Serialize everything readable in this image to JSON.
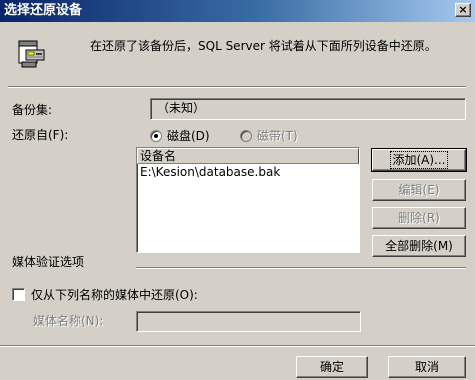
{
  "window": {
    "title": "选择还原设备",
    "close_glyph": "×"
  },
  "header": {
    "icon": "database-device-icon",
    "message": "在还原了该备份后，SQL Server 将试着从下面所列设备中还原。"
  },
  "backup_set": {
    "label": "备份集:",
    "value": "（未知）"
  },
  "restore_from": {
    "label": "还原自(F):",
    "disk_label": "磁盘(D)",
    "tape_label": "磁带(T)",
    "selected": "disk"
  },
  "devices": {
    "column_header": "设备名",
    "items": [
      "E:\\Kesion\\database.bak"
    ]
  },
  "buttons": {
    "add": "添加(A)...",
    "edit": "编辑(E)",
    "remove": "删除(R)",
    "remove_all": "全部删除(M)",
    "ok": "确定",
    "cancel": "取消"
  },
  "media_verification": {
    "section_label": "媒体验证选项",
    "checkbox_label": "仅从下列名称的媒体中还原(O):",
    "checked": false,
    "media_name_label": "媒体名称(N):",
    "media_name_value": ""
  }
}
